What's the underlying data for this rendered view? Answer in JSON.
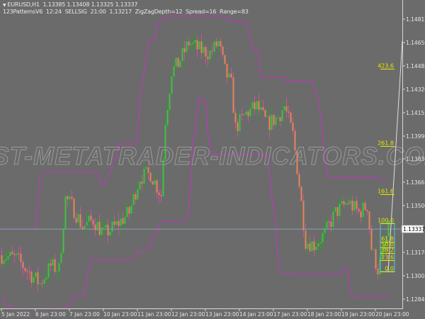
{
  "header": {
    "symbol_line": "EURUSD,H1  1.13385 1.13408 1.13325 1.13337",
    "indicator_line": "123PatternsV6  12:24  SELLSIG  21:00  1.13217  ZigZagDepth=12  Spread=16  Range=83",
    "collapse_icon": "triangle-down-icon"
  },
  "watermark": "BEST-METATRADER-INDICATORS.COM",
  "colors": {
    "background": "#6b6b6b",
    "up": "#3cc43c",
    "down": "#e8845a",
    "bands": "#c832c8",
    "fib": "#e6e600",
    "grid_text": "#e8e8e8",
    "bid_line": "#8aa0b4"
  },
  "chart_data": {
    "type": "candlestick",
    "symbol": "EURUSD",
    "timeframe": "H1",
    "current_price": "1.13337",
    "price_axis_labels": [
      "1.14815",
      "1.14650",
      "1.14485",
      "1.14320",
      "1.14155",
      "1.13990",
      "1.13830",
      "1.13665",
      "1.13500",
      "1.13170",
      "1.13005",
      "1.12840"
    ],
    "ylim": [
      1.12775,
      1.1495
    ],
    "time_axis_labels": [
      "5 Jan 2022",
      "6 Jan 23:00",
      "7 Jan 23:00",
      "10 Jan 23:00",
      "11 Jan 23:00",
      "12 Jan 23:00",
      "13 Jan 23:00",
      "14 Jan 23:00",
      "17 Jan 23:00",
      "18 Jan 23:00",
      "19 Jan 23:00",
      "20 Jan 23:00"
    ],
    "bars_per_label": 16,
    "price_path": [
      [
        0,
        1.1315
      ],
      [
        7,
        1.13125
      ],
      [
        13,
        1.13025
      ],
      [
        18,
        1.1295
      ],
      [
        23,
        1.13075
      ],
      [
        27,
        1.1305
      ],
      [
        30,
        1.1355
      ],
      [
        33,
        1.135
      ],
      [
        38,
        1.1335
      ],
      [
        43,
        1.134
      ],
      [
        48,
        1.133
      ],
      [
        53,
        1.1335
      ],
      [
        60,
        1.1345
      ],
      [
        65,
        1.137
      ],
      [
        70,
        1.13725
      ],
      [
        75,
        1.13575
      ],
      [
        77,
        1.141
      ],
      [
        80,
        1.1445
      ],
      [
        83,
        1.145
      ],
      [
        88,
        1.1465
      ],
      [
        93,
        1.146
      ],
      [
        98,
        1.14575
      ],
      [
        102,
        1.1465
      ],
      [
        105,
        1.1445
      ],
      [
        108,
        1.1435
      ],
      [
        110,
        1.1405
      ],
      [
        115,
        1.1415
      ],
      [
        120,
        1.142
      ],
      [
        125,
        1.14075
      ],
      [
        130,
        1.14125
      ],
      [
        133,
        1.142
      ],
      [
        137,
        1.14
      ],
      [
        140,
        1.1365
      ],
      [
        143,
        1.1325
      ],
      [
        147,
        1.13225
      ],
      [
        152,
        1.133
      ],
      [
        157,
        1.1345
      ],
      [
        163,
        1.13525
      ],
      [
        168,
        1.1345
      ],
      [
        172,
        1.135
      ],
      [
        174,
        1.132
      ],
      [
        177,
        1.1305
      ],
      [
        179,
        1.1315
      ],
      [
        182,
        1.13337
      ]
    ],
    "fib_levels": [
      {
        "label": "423.6",
        "price": 1.14465
      },
      {
        "label": "261.8",
        "price": 1.1392
      },
      {
        "label": "161.8",
        "price": 1.1358
      },
      {
        "label": "100.0",
        "price": 1.13375
      },
      {
        "label": "61.8",
        "price": 1.13245
      },
      {
        "label": "50.0",
        "price": 1.13205
      },
      {
        "label": "38.2",
        "price": 1.13165
      },
      {
        "label": "23.6",
        "price": 1.13115
      },
      {
        "label": "0.0",
        "price": 1.13035
      }
    ]
  }
}
